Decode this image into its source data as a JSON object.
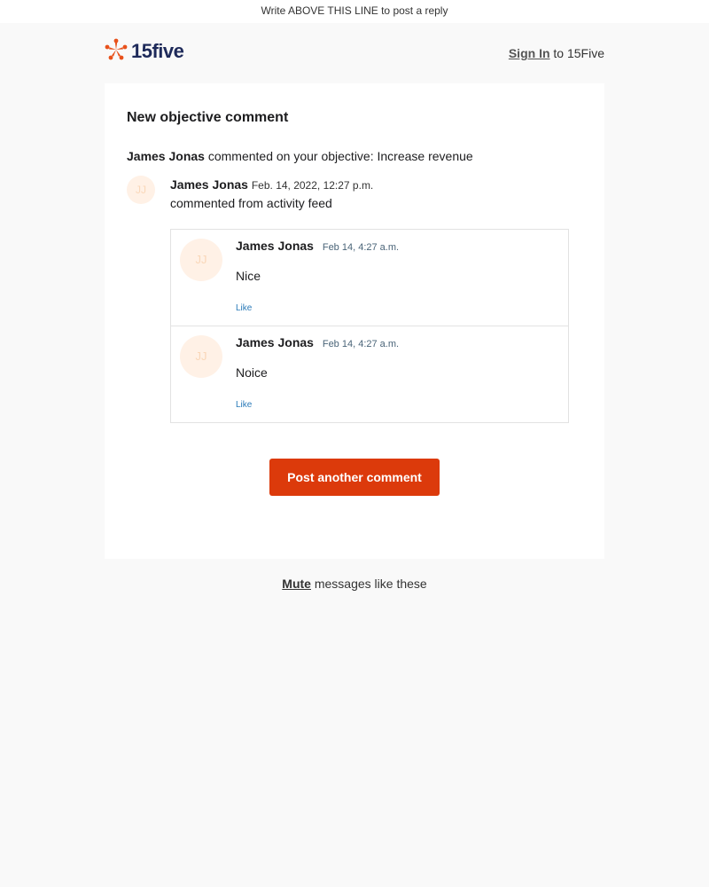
{
  "reply_line": "Write ABOVE THIS LINE to post a reply",
  "header": {
    "logo_text": "15five",
    "sign_in_link": "Sign In",
    "sign_in_suffix": "to 15Five"
  },
  "card": {
    "title": "New objective comment",
    "summary": {
      "author": "James Jonas",
      "text": "commented on your objective: Increase revenue"
    },
    "activity": {
      "avatar_initials": "JJ",
      "author": "James Jonas",
      "date": "Feb. 14, 2022, 12:27 p.m.",
      "source": "commented from activity feed"
    },
    "comments": [
      {
        "avatar_initials": "JJ",
        "author": "James Jonas",
        "date": "Feb 14, 4:27 a.m.",
        "text": "Nice",
        "like_label": "Like"
      },
      {
        "avatar_initials": "JJ",
        "author": "James Jonas",
        "date": "Feb 14, 4:27 a.m.",
        "text": "Noice",
        "like_label": "Like"
      }
    ],
    "button_label": "Post another comment"
  },
  "footer": {
    "mute_link": "Mute",
    "mute_suffix": "messages like these"
  },
  "colors": {
    "accent": "#dc3a0b",
    "logo_navy": "#1e2a5a",
    "logo_orange": "#e8511b",
    "link_blue": "#2a7ab8"
  },
  "icons": {
    "logo": "15five-starburst-icon"
  }
}
